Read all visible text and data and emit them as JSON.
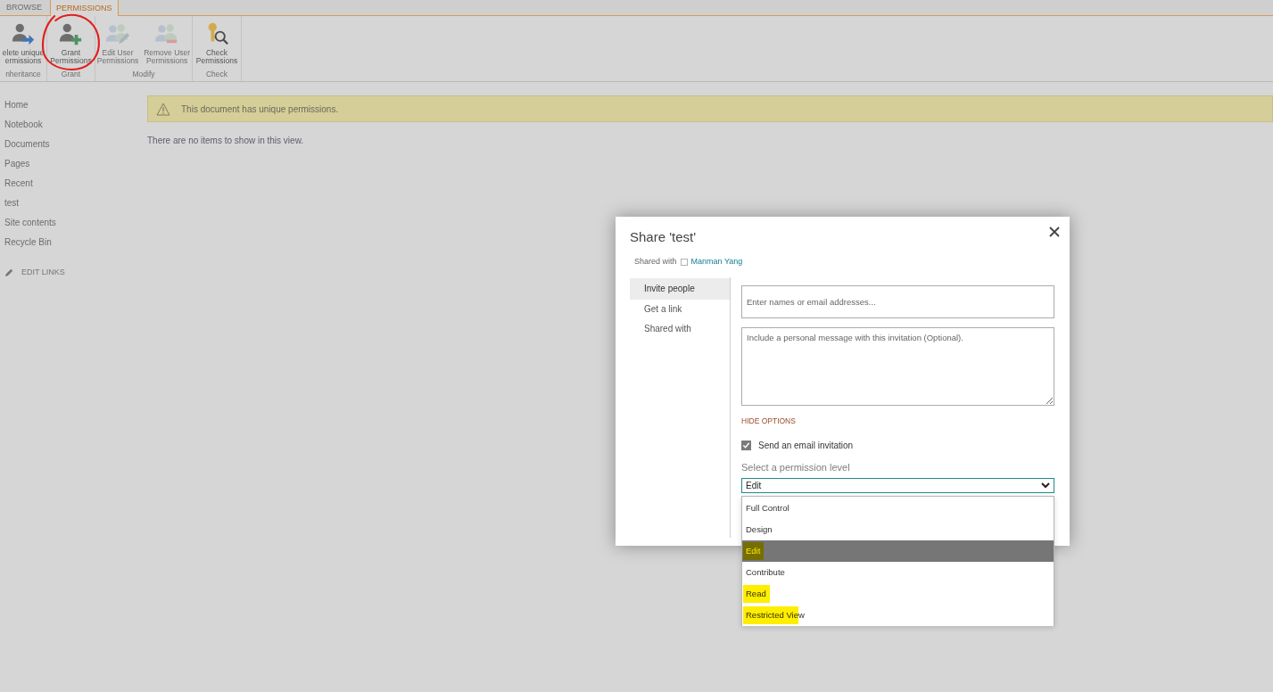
{
  "ribbon": {
    "tabs": [
      {
        "label": "BROWSE",
        "selected": false
      },
      {
        "label": "PERMISSIONS",
        "selected": true
      }
    ],
    "groups": [
      {
        "label": "nheritance",
        "buttons": [
          {
            "lines": [
              "elete unique",
              "ermissions"
            ],
            "disabled": false,
            "circled": false
          }
        ]
      },
      {
        "label": "Grant",
        "buttons": [
          {
            "lines": [
              "Grant",
              "Permissions"
            ],
            "disabled": false,
            "circled": true
          }
        ]
      },
      {
        "label": "Modify",
        "buttons": [
          {
            "lines": [
              "Edit User",
              "Permissions"
            ],
            "disabled": true,
            "circled": false
          },
          {
            "lines": [
              "Remove User",
              "Permissions"
            ],
            "disabled": true,
            "circled": false
          }
        ]
      },
      {
        "label": "Check",
        "buttons": [
          {
            "lines": [
              "Check",
              "Permissions"
            ],
            "disabled": false,
            "circled": false
          }
        ]
      }
    ]
  },
  "nav": {
    "items": [
      "Home",
      "Notebook",
      "Documents",
      "Pages",
      "Recent",
      "test",
      "Site contents",
      "Recycle Bin"
    ],
    "edit_links": "EDIT LINKS"
  },
  "notice": {
    "message": "This document has unique permissions."
  },
  "empty_message": "There are no items to show in this view.",
  "dialog": {
    "title": "Share 'test'",
    "shared_with": {
      "label": "Shared with",
      "people": [
        "Manman Yang"
      ]
    },
    "tabs": [
      {
        "label": "Invite people",
        "selected": true
      },
      {
        "label": "Get a link",
        "selected": false
      },
      {
        "label": "Shared with",
        "selected": false
      }
    ],
    "invite_field": {
      "placeholder": "Enter names or email addresses..."
    },
    "message_field": {
      "placeholder": "Include a personal message with this invitation (Optional)."
    },
    "options_toggle": "HIDE OPTIONS",
    "email_invitation": {
      "label": "Send an email invitation",
      "checked": true
    },
    "permission": {
      "label": "Select a permission level",
      "value": "Edit",
      "options": [
        {
          "label": "Full Control",
          "selected": false,
          "highlighted": false
        },
        {
          "label": "Design",
          "selected": false,
          "highlighted": false
        },
        {
          "label": "Edit",
          "selected": true,
          "highlighted": true
        },
        {
          "label": "Contribute",
          "selected": false,
          "highlighted": false
        },
        {
          "label": "Read",
          "selected": false,
          "highlighted": true
        },
        {
          "label": "Restricted View",
          "selected": false,
          "highlighted": true
        }
      ]
    }
  }
}
